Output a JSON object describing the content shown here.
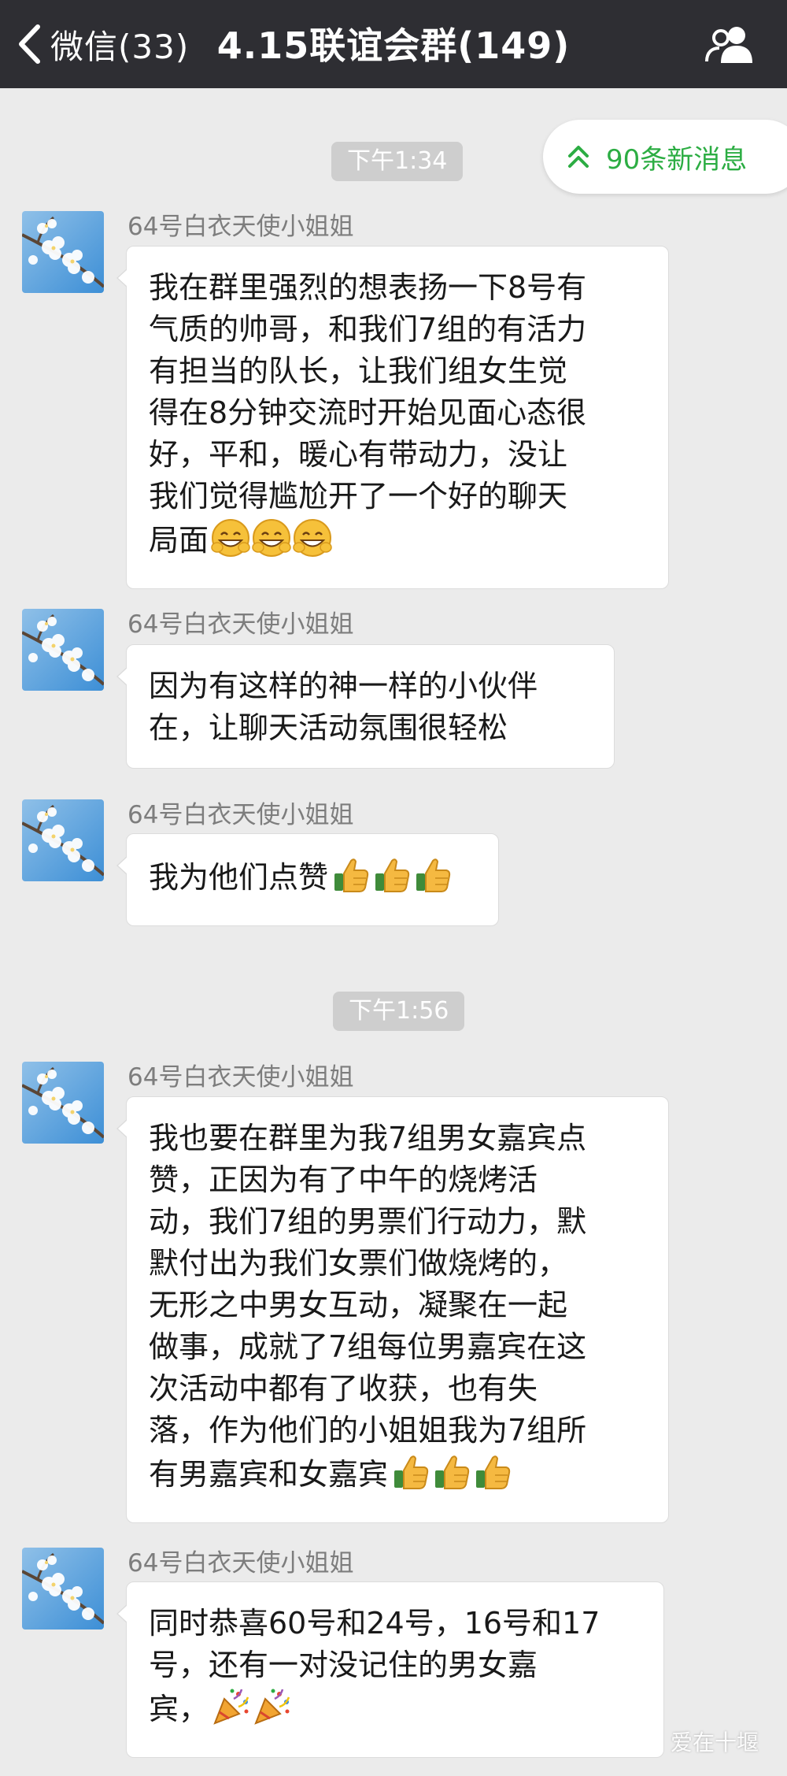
{
  "navbar": {
    "back_label": "微信(33)",
    "title": "4.15联谊会群(149)"
  },
  "new_messages": {
    "label": "90条新消息"
  },
  "time_labels": [
    "下午1:34",
    "下午1:56"
  ],
  "messages": [
    {
      "sender": "64号白衣天使小姐姐",
      "lines": [
        "我在群里强烈的想表扬一下8号有",
        "气质的帅哥，和我们7组的有活力",
        "有担当的队长，让我们组女生觉",
        "得在8分钟交流时开始见面心态很",
        "好，平和，暖心有带动力，没让",
        "我们觉得尴尬开了一个好的聊天",
        "局面"
      ],
      "emoji": [
        "grin-emoji",
        "grin-emoji",
        "grin-emoji"
      ]
    },
    {
      "sender": "64号白衣天使小姐姐",
      "lines": [
        "因为有这样的神一样的小伙伴",
        "在，让聊天活动氛围很轻松"
      ]
    },
    {
      "sender": "64号白衣天使小姐姐",
      "lines": [
        "我为他们点赞"
      ],
      "emoji": [
        "thumbs-up-emoji",
        "thumbs-up-emoji",
        "thumbs-up-emoji"
      ]
    },
    {
      "sender": "64号白衣天使小姐姐",
      "lines": [
        "我也要在群里为我7组男女嘉宾点",
        "赞，正因为有了中午的烧烤活",
        "动，我们7组的男票们行动力，默",
        "默付出为我们女票们做烧烤的，",
        "无形之中男女互动，凝聚在一起",
        "做事，成就了7组每位男嘉宾在这",
        "次活动中都有了收获，也有失",
        "落，作为他们的小姐姐我为7组所",
        "有男嘉宾和女嘉宾"
      ],
      "emoji": [
        "thumbs-up-emoji",
        "thumbs-up-emoji",
        "thumbs-up-emoji"
      ]
    },
    {
      "sender": "64号白衣天使小姐姐",
      "lines": [
        "同时恭喜60号和24号，16号和17",
        "号，还有一对没记住的男女嘉",
        "宾，"
      ],
      "emoji": [
        "party-popper-emoji",
        "party-popper-emoji"
      ]
    }
  ],
  "watermark": {
    "label": "爱在十堰"
  }
}
